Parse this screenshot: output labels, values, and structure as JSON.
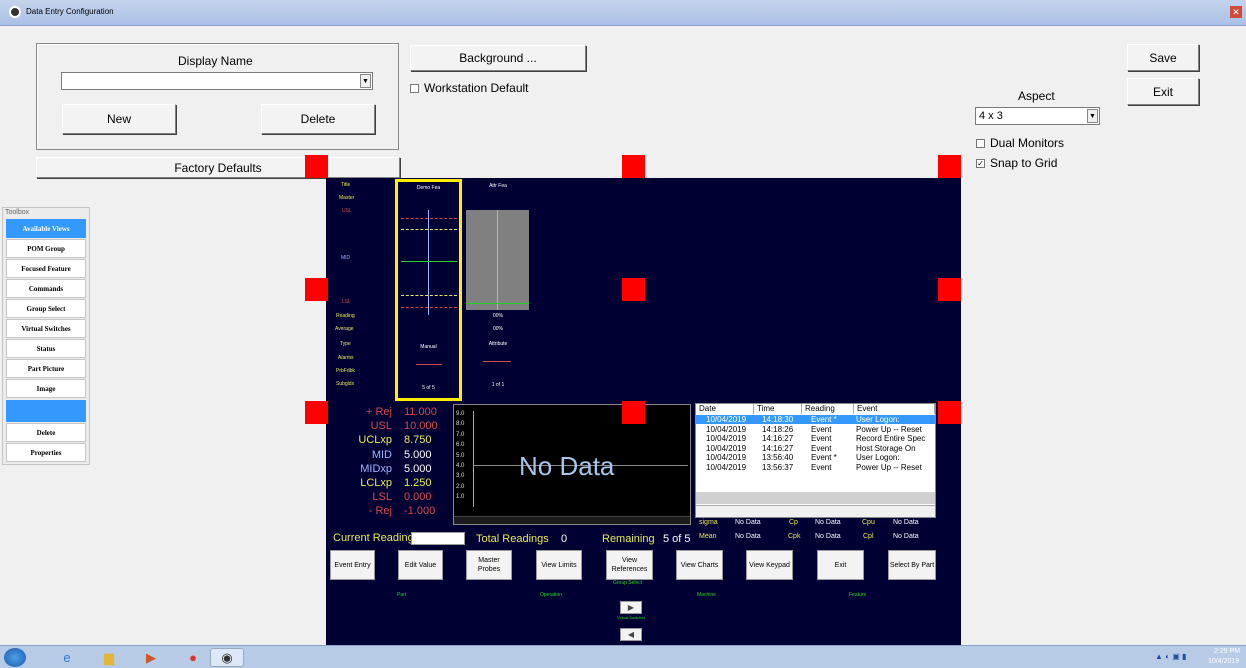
{
  "window": {
    "title": "Data Entry Configuration",
    "close_icon": "close-icon"
  },
  "display_group": {
    "label": "Display Name",
    "combo_value": "",
    "new_label": "New",
    "delete_label": "Delete"
  },
  "factory_defaults": "Factory Defaults",
  "background_button": "Background ...",
  "workstation_default": {
    "label": "Workstation Default",
    "checked": false
  },
  "save_label": "Save",
  "exit_label": "Exit",
  "aspect": {
    "label": "Aspect",
    "value": "4 x 3"
  },
  "dual_monitors": {
    "label": "Dual Monitors",
    "checked": false
  },
  "snap_to_grid": {
    "label": "Snap to Grid",
    "checked": true
  },
  "toolbox": {
    "title": "Toolbox",
    "items": [
      "Available Views",
      "POM Group",
      "Focused Feature",
      "Commands",
      "Group Select",
      "Virtual Switches",
      "Status",
      "Part Picture",
      "Image",
      "",
      "Delete",
      "Properties"
    ]
  },
  "feature_panel": {
    "row_labels": [
      "Title",
      "Master",
      "USL",
      "MID",
      "LSL",
      "Reading",
      "Average",
      "Type",
      "Alarms",
      "PrbFdbk",
      "Subgldx"
    ],
    "col1": {
      "title": "Demo Fea",
      "type": "Manual",
      "subgroup": "5 of 5"
    },
    "col2": {
      "title": "Attr Fea",
      "reading": "00%",
      "average": "00%",
      "type": "Attribute",
      "subgroup": "1 of 1"
    }
  },
  "limits": [
    {
      "label": "+ Rej",
      "value": "11.000",
      "color": "#d34a4a"
    },
    {
      "label": "USL",
      "value": "10.000",
      "color": "#d34a4a"
    },
    {
      "label": "UCLxp",
      "value": "8.750",
      "color": "#e8e85a"
    },
    {
      "label": "MID",
      "value": "5.000",
      "color": "#9fb3ff"
    },
    {
      "label": "MIDxp",
      "value": "5.000",
      "color": "#9fb3ff"
    },
    {
      "label": "LCLxp",
      "value": "1.250",
      "color": "#e8e85a"
    },
    {
      "label": "LSL",
      "value": "0.000",
      "color": "#d34a4a"
    },
    {
      "label": "- Rej",
      "value": "-1.000",
      "color": "#d34a4a"
    }
  ],
  "chart": {
    "no_data": "No Data",
    "y_ticks": [
      "9.0",
      "8.0",
      "7.0",
      "6.0",
      "5.0",
      "4.0",
      "3.0",
      "2.0",
      "1.0"
    ]
  },
  "event_log": {
    "headers": [
      "Date",
      "Time",
      "Reading",
      "Event"
    ],
    "rows": [
      [
        "10/04/2019",
        "14:18:30",
        "Event *",
        "User Logon:"
      ],
      [
        "10/04/2019",
        "14:18:26",
        "Event",
        "Power Up -- Reset"
      ],
      [
        "10/04/2019",
        "14:16:27",
        "Event",
        "Record Entire Spec"
      ],
      [
        "10/04/2019",
        "14:16:27",
        "Event",
        "Host Storage On"
      ],
      [
        "10/04/2019",
        "13:56:40",
        "Event *",
        "User Logon:"
      ],
      [
        "10/04/2019",
        "13:56:37",
        "Event",
        "Power Up -- Reset"
      ]
    ]
  },
  "stats": {
    "sigma": "sigma",
    "sigma_v": "No Data",
    "cp": "Cp",
    "cp_v": "No Data",
    "cpu": "Cpu",
    "cpu_v": "No Data",
    "mean": "Mean",
    "mean_v": "No Data",
    "cpk": "Cpk",
    "cpk_v": "No Data",
    "cpl": "Cpl",
    "cpl_v": "No Data"
  },
  "readings": {
    "current": "Current Reading",
    "total": "Total Readings",
    "total_v": "0",
    "remaining": "Remaining",
    "remaining_v": "5 of 5"
  },
  "command_buttons": [
    "Event Entry",
    "Edit Value",
    "Master Probes",
    "View Limits",
    "View References",
    "View Charts",
    "View Keypad",
    "Exit",
    "Select By Part"
  ],
  "group_select": "Group Select",
  "group_labels": [
    "Part",
    "Operation",
    "Machine",
    "Feature"
  ],
  "virtual_switches": "Virtual Switches",
  "clock": {
    "time": "2:29 PM",
    "date": "10/4/2019"
  }
}
